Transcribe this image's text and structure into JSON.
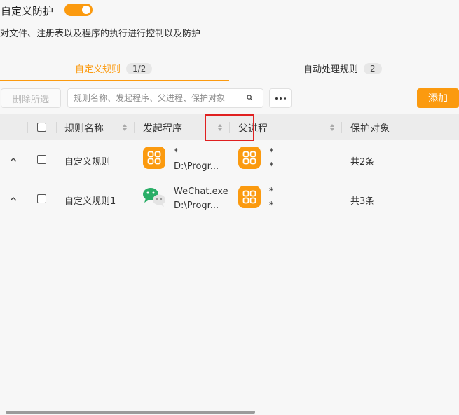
{
  "header": {
    "title": "自定义防护",
    "toggle_on": true,
    "description": "对文件、注册表以及程序的执行进行控制以及防护"
  },
  "tabs": [
    {
      "label": "自定义规则",
      "count": "1/2",
      "active": true
    },
    {
      "label": "自动处理规则",
      "count": "2",
      "active": false
    }
  ],
  "toolbar": {
    "delete_label": "删除所选",
    "search_placeholder": "规则名称、发起程序、父进程、保护对象",
    "add_label": "添加"
  },
  "table": {
    "columns": [
      "规则名称",
      "发起程序",
      "父进程",
      "保护对象"
    ],
    "rows": [
      {
        "name": "自定义规则",
        "initiator_icon": "app-grid-icon",
        "initiator_name": "*",
        "initiator_path": "D:\\Progr...",
        "parent_icon": "app-grid-icon",
        "parent_line1": "*",
        "parent_line2": "*",
        "protect": "共2条"
      },
      {
        "name": "自定义规则1",
        "initiator_icon": "wechat-icon",
        "initiator_name": "WeChat.exe",
        "initiator_path": "D:\\Progr...",
        "parent_icon": "app-grid-icon",
        "parent_line1": "*",
        "parent_line2": "*",
        "protect": "共3条"
      }
    ]
  },
  "colors": {
    "accent": "#fb9a0f",
    "highlight": "#e02020"
  }
}
